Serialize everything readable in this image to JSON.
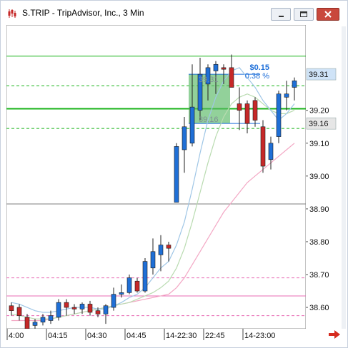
{
  "window": {
    "title": "S.TRIP - TripAdvisor, Inc., 3 Min",
    "icon": "candlestick-chart-icon",
    "buttons": [
      "minimize-icon",
      "maximize-icon",
      "close-icon"
    ],
    "close_color": "#c9483c"
  },
  "colors": {
    "up": "#1f6fd6",
    "down": "#c62828",
    "level_green": "#19b319",
    "level_pink": "#e86bb4",
    "ma_fast": "#9fc6e6",
    "ma_mid": "#b9dbb0",
    "ma_slow": "#f3a7c4",
    "gray_line": "#7f7f7f",
    "selection_fill": "#58b864",
    "gain_text": "#1e6fd9"
  },
  "chart_data": {
    "type": "candlestick",
    "symbol": "S.TRIP",
    "company": "TripAdvisor, Inc.",
    "interval": "3 Min",
    "ylim": [
      38.535,
      39.46
    ],
    "y_ticks": [
      "39.20",
      "39.10",
      "39.00",
      "38.90",
      "38.80",
      "38.70",
      "38.60"
    ],
    "y_tick_values": [
      39.2,
      39.1,
      39.0,
      38.9,
      38.8,
      38.7,
      38.6
    ],
    "x_ticks": [
      "4:00",
      "04:15",
      "04:30",
      "04:45",
      "14-22:30",
      "22:45",
      "14-23:00"
    ],
    "x_tick_index": [
      0,
      5,
      10,
      15,
      20,
      25,
      30
    ],
    "candles": [
      {
        "o": 38.605,
        "h": 38.615,
        "l": 38.575,
        "c": 38.59
      },
      {
        "o": 38.6,
        "h": 38.61,
        "l": 38.56,
        "c": 38.575
      },
      {
        "o": 38.57,
        "h": 38.58,
        "l": 38.53,
        "c": 38.535
      },
      {
        "o": 38.545,
        "h": 38.565,
        "l": 38.535,
        "c": 38.555
      },
      {
        "o": 38.555,
        "h": 38.58,
        "l": 38.545,
        "c": 38.57
      },
      {
        "o": 38.56,
        "h": 38.59,
        "l": 38.55,
        "c": 38.575
      },
      {
        "o": 38.57,
        "h": 38.625,
        "l": 38.56,
        "c": 38.615
      },
      {
        "o": 38.615,
        "h": 38.625,
        "l": 38.575,
        "c": 38.6
      },
      {
        "o": 38.6,
        "h": 38.61,
        "l": 38.58,
        "c": 38.595
      },
      {
        "o": 38.595,
        "h": 38.615,
        "l": 38.58,
        "c": 38.61
      },
      {
        "o": 38.61,
        "h": 38.62,
        "l": 38.575,
        "c": 38.585
      },
      {
        "o": 38.59,
        "h": 38.6,
        "l": 38.57,
        "c": 38.58
      },
      {
        "o": 38.58,
        "h": 38.61,
        "l": 38.55,
        "c": 38.605
      },
      {
        "o": 38.6,
        "h": 38.66,
        "l": 38.59,
        "c": 38.64
      },
      {
        "o": 38.64,
        "h": 38.67,
        "l": 38.63,
        "c": 38.645
      },
      {
        "o": 38.645,
        "h": 38.7,
        "l": 38.64,
        "c": 38.69
      },
      {
        "o": 38.68,
        "h": 38.69,
        "l": 38.645,
        "c": 38.65
      },
      {
        "o": 38.65,
        "h": 38.75,
        "l": 38.645,
        "c": 38.74
      },
      {
        "o": 38.72,
        "h": 38.81,
        "l": 38.7,
        "c": 38.77
      },
      {
        "o": 38.76,
        "h": 38.82,
        "l": 38.71,
        "c": 38.79
      },
      {
        "o": 38.79,
        "h": 38.8,
        "l": 38.74,
        "c": 38.78
      },
      {
        "o": 38.92,
        "h": 39.1,
        "l": 38.92,
        "c": 39.09
      },
      {
        "o": 39.08,
        "h": 39.18,
        "l": 39.01,
        "c": 39.15
      },
      {
        "o": 39.1,
        "h": 39.34,
        "l": 39.09,
        "c": 39.21
      },
      {
        "o": 39.2,
        "h": 39.36,
        "l": 39.17,
        "c": 39.31
      },
      {
        "o": 39.28,
        "h": 39.34,
        "l": 39.23,
        "c": 39.33
      },
      {
        "o": 39.32,
        "h": 39.35,
        "l": 39.25,
        "c": 39.34
      },
      {
        "o": 39.33,
        "h": 39.34,
        "l": 39.28,
        "c": 39.325
      },
      {
        "o": 39.33,
        "h": 39.37,
        "l": 39.29,
        "c": 39.27
      },
      {
        "o": 39.22,
        "h": 39.27,
        "l": 39.14,
        "c": 39.2
      },
      {
        "o": 39.22,
        "h": 39.23,
        "l": 39.13,
        "c": 39.16
      },
      {
        "o": 39.23,
        "h": 39.24,
        "l": 39.15,
        "c": 39.17
      },
      {
        "o": 39.15,
        "h": 39.17,
        "l": 39.01,
        "c": 39.03
      },
      {
        "o": 39.05,
        "h": 39.12,
        "l": 39.02,
        "c": 39.1
      },
      {
        "o": 39.12,
        "h": 39.26,
        "l": 39.1,
        "c": 39.25
      },
      {
        "o": 39.24,
        "h": 39.29,
        "l": 39.2,
        "c": 39.25
      },
      {
        "o": 39.27,
        "h": 39.3,
        "l": 39.23,
        "c": 39.29
      }
    ],
    "ma_fast": [
      38.615,
      38.61,
      38.6,
      38.59,
      38.585,
      38.585,
      38.59,
      38.595,
      38.6,
      38.6,
      38.6,
      38.595,
      38.595,
      38.605,
      38.615,
      38.63,
      38.64,
      38.66,
      38.69,
      38.72,
      38.74,
      38.79,
      38.86,
      38.96,
      39.07,
      39.17,
      39.24,
      39.29,
      39.32,
      39.33,
      39.3,
      39.27,
      39.23,
      39.2,
      39.17,
      39.19,
      39.22
    ],
    "ma_mid": [
      38.58,
      38.575,
      38.57,
      38.565,
      38.565,
      38.565,
      38.57,
      38.575,
      38.58,
      38.585,
      38.59,
      38.595,
      38.6,
      38.605,
      38.61,
      38.615,
      38.625,
      38.635,
      38.645,
      38.66,
      38.68,
      38.72,
      38.78,
      38.86,
      38.95,
      39.04,
      39.12,
      39.18,
      39.22,
      39.24,
      39.25,
      39.24,
      39.22,
      39.2,
      39.19,
      39.19,
      39.2
    ],
    "ma_slow": [
      38.56,
      38.56,
      38.56,
      38.56,
      38.56,
      38.565,
      38.57,
      38.575,
      38.58,
      38.585,
      38.59,
      38.595,
      38.6,
      38.605,
      38.61,
      38.615,
      38.62,
      38.625,
      38.63,
      38.635,
      38.64,
      38.66,
      38.69,
      38.73,
      38.77,
      38.81,
      38.85,
      38.89,
      38.92,
      38.95,
      38.98,
      39.0,
      39.02,
      39.04,
      39.06,
      39.08,
      39.1
    ],
    "levels": [
      {
        "value": 39.365,
        "color": "green",
        "style": "solid"
      },
      {
        "value": 39.275,
        "color": "green",
        "style": "dashed"
      },
      {
        "value": 39.205,
        "color": "green",
        "style": "solid-bold"
      },
      {
        "value": 39.145,
        "color": "green",
        "style": "dashed"
      },
      {
        "value": 38.915,
        "color": "gray",
        "style": "solid"
      },
      {
        "value": 38.69,
        "color": "pink",
        "style": "dashed"
      },
      {
        "value": 38.635,
        "color": "pink",
        "style": "solid"
      },
      {
        "value": 38.575,
        "color": "pink",
        "style": "dashed"
      }
    ],
    "measure": {
      "start_index": 23,
      "end_index": 28,
      "low": 39.16,
      "high": 39.31,
      "high_label": "39.31",
      "low_label": "39.16",
      "change_label": "$0.15",
      "percent_label": "0.38 %"
    },
    "price_flags": [
      {
        "value": 39.31,
        "label": "39.31",
        "bg": "#cfe3f7"
      },
      {
        "value": 39.16,
        "label": "39.16",
        "bg": "#e6e6e6"
      }
    ]
  }
}
